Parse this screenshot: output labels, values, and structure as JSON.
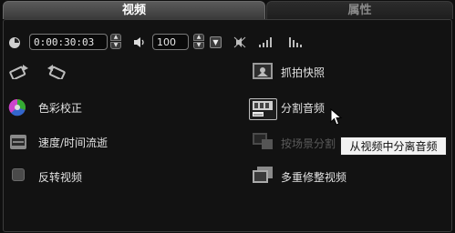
{
  "tabs": [
    {
      "label": "视频",
      "active": true
    },
    {
      "label": "属性",
      "active": false
    }
  ],
  "toolbar": {
    "timecode": "0:00:30:03",
    "volume": "100"
  },
  "left_actions": [
    {
      "label": "色彩校正",
      "icon": "color-wheel-icon"
    },
    {
      "label": "速度/时间流逝",
      "icon": "speed-icon"
    },
    {
      "label": "反转视频",
      "icon": "checkbox",
      "checked": false
    }
  ],
  "right_actions": [
    {
      "label": "抓拍快照",
      "icon": "snapshot-icon",
      "enabled": true
    },
    {
      "label": "分割音频",
      "icon": "split-audio-icon",
      "enabled": true
    },
    {
      "label": "按场景分割",
      "icon": "scene-split-icon",
      "enabled": false
    },
    {
      "label": "多重修整视频",
      "icon": "multi-trim-icon",
      "enabled": true
    }
  ],
  "tooltip": "从视频中分离音频",
  "colors": {
    "background": "#0f0f0f",
    "active_tab": "#4a4a4a",
    "text": "#e2e2e2",
    "disabled_text": "#5a5a5a",
    "tooltip_bg": "#f2f2f2"
  }
}
